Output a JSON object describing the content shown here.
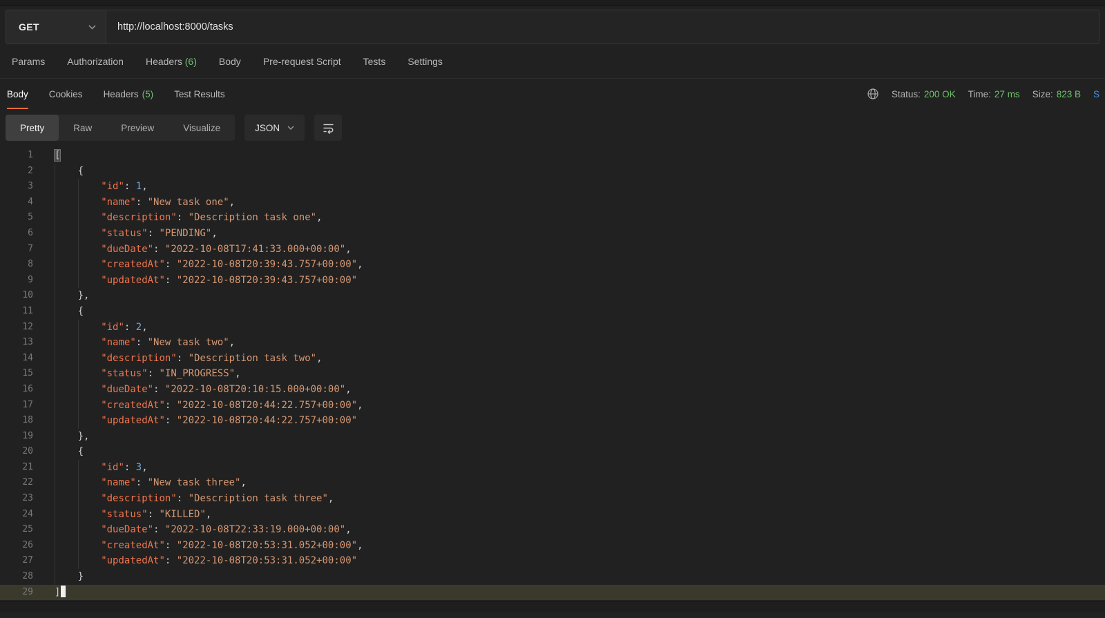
{
  "request": {
    "method": "GET",
    "url": "http://localhost:8000/tasks",
    "tabs": [
      {
        "label": "Params",
        "count": ""
      },
      {
        "label": "Authorization",
        "count": ""
      },
      {
        "label": "Headers",
        "count": "(6)"
      },
      {
        "label": "Body",
        "count": ""
      },
      {
        "label": "Pre-request Script",
        "count": ""
      },
      {
        "label": "Tests",
        "count": ""
      },
      {
        "label": "Settings",
        "count": ""
      }
    ]
  },
  "response": {
    "tabs": [
      {
        "label": "Body",
        "count": "",
        "active": true
      },
      {
        "label": "Cookies",
        "count": "",
        "active": false
      },
      {
        "label": "Headers",
        "count": "(5)",
        "active": false
      },
      {
        "label": "Test Results",
        "count": "",
        "active": false
      }
    ],
    "meta": {
      "status_label": "Status:",
      "status_value": "200 OK",
      "time_label": "Time:",
      "time_value": "27 ms",
      "size_label": "Size:",
      "size_value": "823 B",
      "save_partial": "S"
    },
    "view_tabs": [
      {
        "label": "Pretty",
        "active": true
      },
      {
        "label": "Raw",
        "active": false
      },
      {
        "label": "Preview",
        "active": false
      },
      {
        "label": "Visualize",
        "active": false
      }
    ],
    "format_select": "JSON"
  },
  "code": {
    "key_order": [
      "id",
      "name",
      "description",
      "status",
      "dueDate",
      "createdAt",
      "updatedAt"
    ],
    "tasks": [
      {
        "id": 1,
        "name": "New task one",
        "description": "Description task one",
        "status": "PENDING",
        "dueDate": "2022-10-08T17:41:33.000+00:00",
        "createdAt": "2022-10-08T20:39:43.757+00:00",
        "updatedAt": "2022-10-08T20:39:43.757+00:00"
      },
      {
        "id": 2,
        "name": "New task two",
        "description": "Description task two",
        "status": "IN_PROGRESS",
        "dueDate": "2022-10-08T20:10:15.000+00:00",
        "createdAt": "2022-10-08T20:44:22.757+00:00",
        "updatedAt": "2022-10-08T20:44:22.757+00:00"
      },
      {
        "id": 3,
        "name": "New task three",
        "description": "Description task three",
        "status": "KILLED",
        "dueDate": "2022-10-08T22:33:19.000+00:00",
        "createdAt": "2022-10-08T20:53:31.052+00:00",
        "updatedAt": "2022-10-08T20:53:31.052+00:00"
      }
    ]
  },
  "colors": {
    "accent_orange": "#ff6c37",
    "green": "#6fc26f",
    "blue_link": "#4a90e2",
    "key": "#f0764f",
    "string": "#d79873",
    "number": "#6fa8dc"
  }
}
